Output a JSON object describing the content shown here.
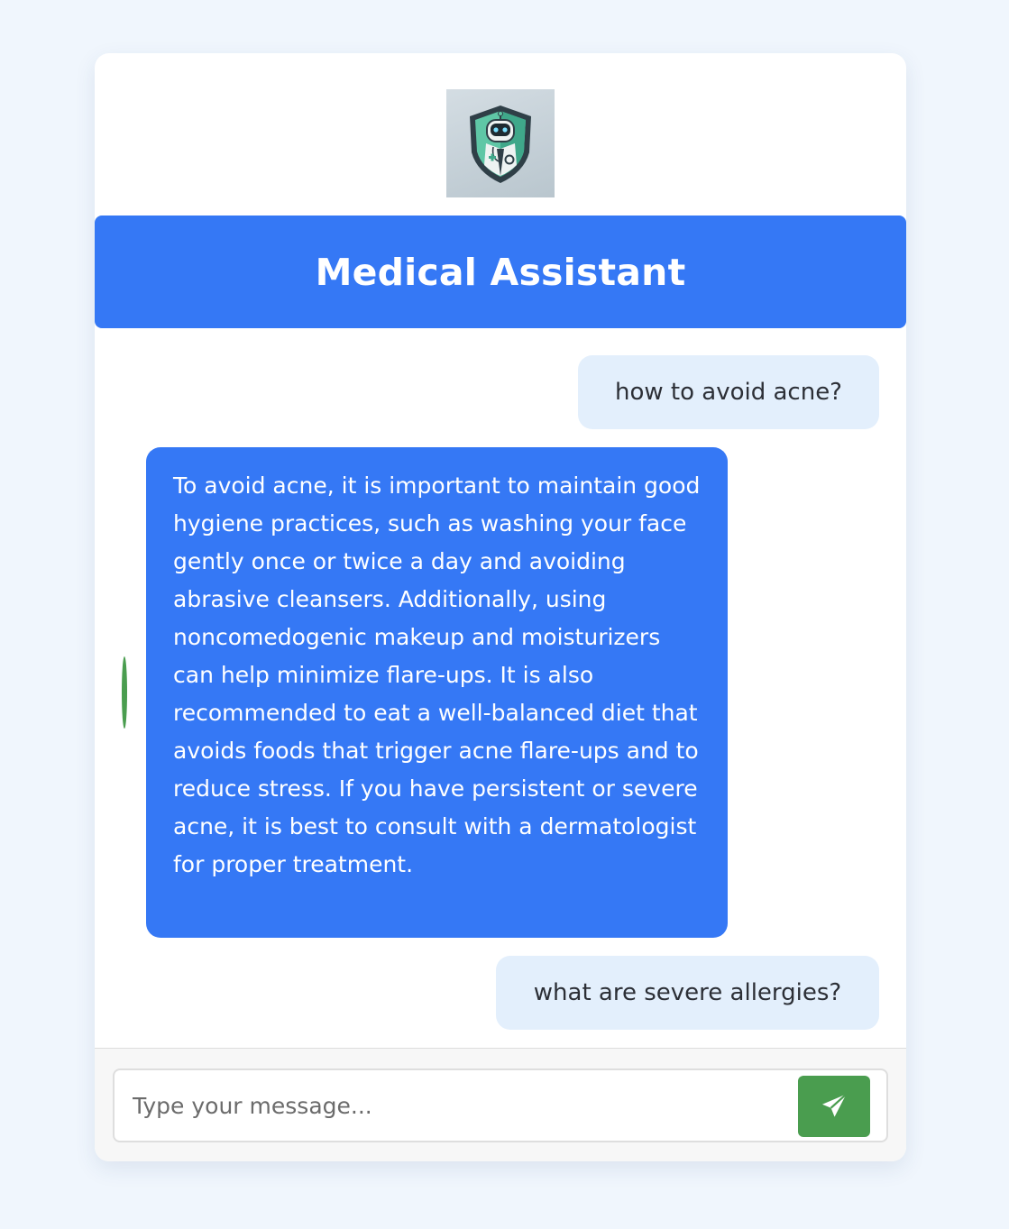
{
  "header": {
    "title": "Medical Assistant",
    "logo_icon": "robot-doctor-shield-icon"
  },
  "messages": [
    {
      "role": "user",
      "text": "how to avoid acne?"
    },
    {
      "role": "assistant",
      "text": "To avoid acne, it is important to maintain good hygiene practices, such as washing your face gently once or twice a day and avoiding abrasive cleansers. Additionally, using noncomedogenic makeup and moisturizers can help minimize flare-ups. It is also recommended to eat a well-balanced diet that avoids foods that trigger acne flare-ups and to reduce stress. If you have persistent or severe acne, it is best to consult with a dermatologist for proper treatment."
    },
    {
      "role": "user",
      "text": "what are severe allergies?"
    }
  ],
  "composer": {
    "placeholder": "Type your message...",
    "value": "",
    "send_icon": "paper-plane-icon"
  },
  "colors": {
    "primary": "#3578f5",
    "user_bubble": "#e3effc",
    "send_button": "#4a9d4f",
    "background": "#f0f6fd"
  }
}
